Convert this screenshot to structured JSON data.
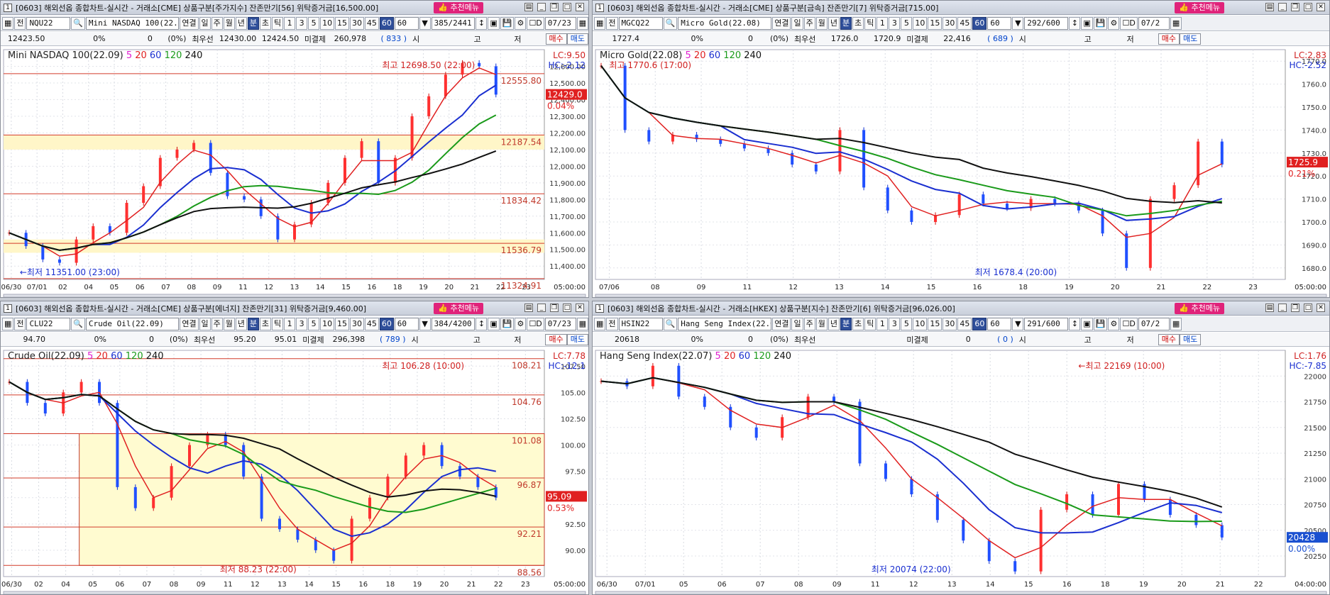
{
  "panels": [
    {
      "title": "[0603] 해외선옵 종합차트-실시간 - 거래소[CME] 상품구분[주가지수] 잔존만기[56] 위탁증거금[16,500.00]",
      "recommend_label": "추천메뉴",
      "tooltip": "추천메뉴",
      "code": "NQU22",
      "name": "Mini NASDAQ 100(22.0",
      "date": "07/23",
      "counter": "385",
      "counter_total": "/2441",
      "interval_value": "60",
      "quote": {
        "price": "12423.50",
        "change": "0%",
        "qty": "0",
        "pct": "0%",
        "label_best": "최우선",
        "bid": "12430.00",
        "ask": "12424.50",
        "label_oi": "미결제",
        "oi": "260,978",
        "oi_change": "833",
        "open_label": "시",
        "high_label": "고",
        "low_label": "저",
        "buy_label": "매수",
        "sell_label": "매도"
      },
      "chart_data": {
        "type": "line",
        "title": "Mini NASDAQ 100(22.09)",
        "ma_periods": [
          "5",
          "20",
          "60",
          "120",
          "240"
        ],
        "ma_colors": [
          "#e01ed0",
          "#e02020",
          "#1a2fd0",
          "#1a9a1a",
          "#111111"
        ],
        "x_ticks": [
          "06/30",
          "07/01",
          "02",
          "04",
          "05",
          "06",
          "07",
          "08",
          "09",
          "11",
          "12",
          "13",
          "14",
          "15",
          "16",
          "18",
          "19",
          "20",
          "21",
          "22",
          "23"
        ],
        "y_ticks": [
          "12,600.00",
          "12,500.00",
          "12,400.00",
          "12,300.00",
          "12,200.00",
          "12,100.00",
          "12,000.00",
          "11,900.00",
          "11,800.00",
          "11,700.00",
          "11,600.00",
          "11,500.00",
          "11,400.00"
        ],
        "ylim": [
          11320,
          12700
        ],
        "h_levels": [
          "12555.80",
          "12187.54",
          "11834.42",
          "11536.79",
          "11324.91"
        ],
        "high_label": "최고 12698.50 (22:00)",
        "low_label": "←최저 11351.00 (23:00)",
        "lc": "LC:9.50",
        "hc": "HC:-2.12",
        "last": "12429.0",
        "last_pct": "0.04%",
        "time_label": "05:00:00",
        "series": [
          {
            "name": "Close",
            "values": [
              11600,
              11520,
              11440,
              11420,
              11560,
              11640,
              11600,
              11780,
              11880,
              12050,
              12100,
              12140,
              11960,
              11820,
              11800,
              11700,
              11560,
              11650,
              11780,
              11900,
              12050,
              12150,
              11900,
              12050,
              12300,
              12420,
              12550,
              12620,
              12600,
              12430
            ]
          }
        ]
      }
    },
    {
      "title": "[0603] 해외선옵 종합차트-실시간 - 거래소[CME] 상품구분[금속] 잔존만기[7] 위탁증거금[715.00]",
      "recommend_label": "추천메뉴",
      "code": "MGCQ22",
      "name": "Micro Gold(22.08)",
      "date": "07/2",
      "counter": "292",
      "counter_total": "/600",
      "interval_value": "60",
      "quote": {
        "price": "1727.4",
        "change": "0%",
        "qty": "0",
        "pct": "0%",
        "label_best": "최우선",
        "bid": "1726.0",
        "ask": "1720.9",
        "label_oi": "미결제",
        "oi": "22,416",
        "oi_change": "689",
        "open_label": "시",
        "high_label": "고",
        "low_label": "저",
        "buy_label": "매수",
        "sell_label": "매도"
      },
      "chart_data": {
        "type": "line",
        "title": "Micro Gold(22.08)",
        "ma_periods": [
          "5",
          "20",
          "60",
          "120",
          "240"
        ],
        "ma_colors": [
          "#e01ed0",
          "#e02020",
          "#1a2fd0",
          "#1a9a1a",
          "#111111"
        ],
        "x_ticks": [
          "07/06",
          "08",
          "09",
          "11",
          "12",
          "13",
          "14",
          "15",
          "16",
          "18",
          "19",
          "20",
          "21",
          "22",
          "23"
        ],
        "y_ticks": [
          "1770.0",
          "1760.0",
          "1750.0",
          "1740.0",
          "1730.0",
          "1720.0",
          "1710.0",
          "1700.0",
          "1690.0",
          "1680.0"
        ],
        "ylim": [
          1675,
          1775
        ],
        "high_label": "최고 1770.6 (17:00)",
        "low_label": "최저 1678.4 (20:00)",
        "lc": "LC:2.83",
        "hc": "HC:-2.52",
        "last": "1725.9",
        "last_pct": "0.21%",
        "time_label": "05:00:00",
        "series": [
          {
            "name": "Close",
            "values": [
              1768,
              1740,
              1735,
              1738,
              1736,
              1734,
              1732,
              1730,
              1725,
              1722,
              1740,
              1715,
              1705,
              1700,
              1703,
              1712,
              1708,
              1706,
              1710,
              1708,
              1705,
              1695,
              1680,
              1710,
              1716,
              1735,
              1725
            ]
          }
        ]
      }
    },
    {
      "title": "[0603] 해외선옵 종합차트-실시간 - 거래소[CME] 상품구분[에너지] 잔존만기[31] 위탁증거금[9,460.00]",
      "recommend_label": "추천메뉴",
      "code": "CLU22",
      "name": "Crude Oil(22.09)",
      "date": "07/23",
      "counter": "384",
      "counter_total": "/4200",
      "interval_value": "60",
      "quote": {
        "price": "94.70",
        "change": "0%",
        "qty": "0",
        "pct": "0%",
        "label_best": "최우선",
        "bid": "95.20",
        "ask": "95.01",
        "label_oi": "미결제",
        "oi": "296,398",
        "oi_change": "789",
        "open_label": "시",
        "high_label": "고",
        "low_label": "저",
        "buy_label": "매수",
        "sell_label": "매도"
      },
      "chart_data": {
        "type": "line",
        "title": "Crude Oil(22.09)",
        "ma_periods": [
          "5",
          "20",
          "60",
          "120",
          "240"
        ],
        "ma_colors": [
          "#e01ed0",
          "#e02020",
          "#1a2fd0",
          "#1a9a1a",
          "#111111"
        ],
        "x_ticks": [
          "06/30",
          "02",
          "04",
          "05",
          "06",
          "07",
          "08",
          "09",
          "11",
          "12",
          "13",
          "14",
          "15",
          "16",
          "18",
          "19",
          "20",
          "21",
          "22",
          "23"
        ],
        "y_ticks": [
          "107.50",
          "105.00",
          "102.50",
          "100.00",
          "97.50",
          "95.00",
          "92.50",
          "90.00"
        ],
        "ylim": [
          87.5,
          109
        ],
        "h_levels": [
          "108.21",
          "104.76",
          "101.08",
          "96.87",
          "92.21",
          "88.56"
        ],
        "high_label": "최고 106.28 (10:00)",
        "low_label": "최저 88.23 (22:00)",
        "lc": "LC:7.78",
        "hc": "HC:-12.1",
        "last": "95.09",
        "last_pct": "0.53%",
        "time_label": "05:00:00",
        "series": [
          {
            "name": "Close",
            "values": [
              106,
              104,
              103,
              105,
              106,
              104,
              96,
              94,
              95,
              98,
              100,
              101,
              100,
              97,
              93,
              92,
              91,
              90,
              89,
              93,
              95,
              97,
              99,
              100,
              98,
              97,
              96,
              95
            ]
          }
        ]
      }
    },
    {
      "title": "[0603] 해외선옵 종합차트-실시간 - 거래소[HKEX] 상품구분[지수] 잔존만기[6] 위탁증거금[96,026.00]",
      "recommend_label": "추천메뉴",
      "code": "HSIN22",
      "name": "Hang Seng Index(22.0",
      "date": "07/2",
      "counter": "291",
      "counter_total": "/600",
      "interval_value": "60",
      "quote": {
        "price": "20618",
        "change": "0%",
        "qty": "0",
        "pct": "0%",
        "label_best": "최우선",
        "bid": "",
        "ask": "",
        "label_oi": "미결제",
        "oi": "0",
        "oi_change": "0",
        "open_label": "시",
        "high_label": "고",
        "low_label": "저",
        "buy_label": "매수",
        "sell_label": "매도"
      },
      "chart_data": {
        "type": "line",
        "title": "Hang Seng Index(22.07)",
        "ma_periods": [
          "5",
          "20",
          "60",
          "120",
          "240"
        ],
        "ma_colors": [
          "#e01ed0",
          "#e02020",
          "#1a2fd0",
          "#1a9a1a",
          "#111111"
        ],
        "x_ticks": [
          "06/30",
          "07/01",
          "05",
          "06",
          "07",
          "08",
          "09",
          "11",
          "12",
          "13",
          "14",
          "15",
          "16",
          "18",
          "19",
          "20",
          "21",
          "22"
        ],
        "y_ticks": [
          "22000",
          "21750",
          "21500",
          "21250",
          "21000",
          "20750",
          "20500",
          "20250"
        ],
        "ylim": [
          20050,
          22250
        ],
        "high_label": "←최고 22169 (10:00)",
        "low_label": "최저 20074 (22:00)",
        "lc": "LC:1.76",
        "hc": "HC:-7.85",
        "last": "20428",
        "last_pct": "0.00%",
        "time_label": "04:00:00",
        "series": [
          {
            "name": "Close",
            "values": [
              21950,
              21900,
              22100,
              21800,
              21700,
              21500,
              21400,
              21600,
              21800,
              21750,
              21150,
              21000,
              20850,
              20600,
              20400,
              20200,
              20100,
              20700,
              20850,
              20650,
              20950,
              20800,
              20650,
              20550,
              20430
            ]
          }
        ]
      }
    }
  ],
  "toolbar": {
    "jeon": "전",
    "link": "연결",
    "day": "일",
    "week": "주",
    "month": "월",
    "year": "년",
    "min": "분",
    "sec": "초",
    "tick": "틱",
    "intervals": [
      "1",
      "3",
      "5",
      "10",
      "15",
      "30",
      "45",
      "60"
    ],
    "d": "D"
  }
}
